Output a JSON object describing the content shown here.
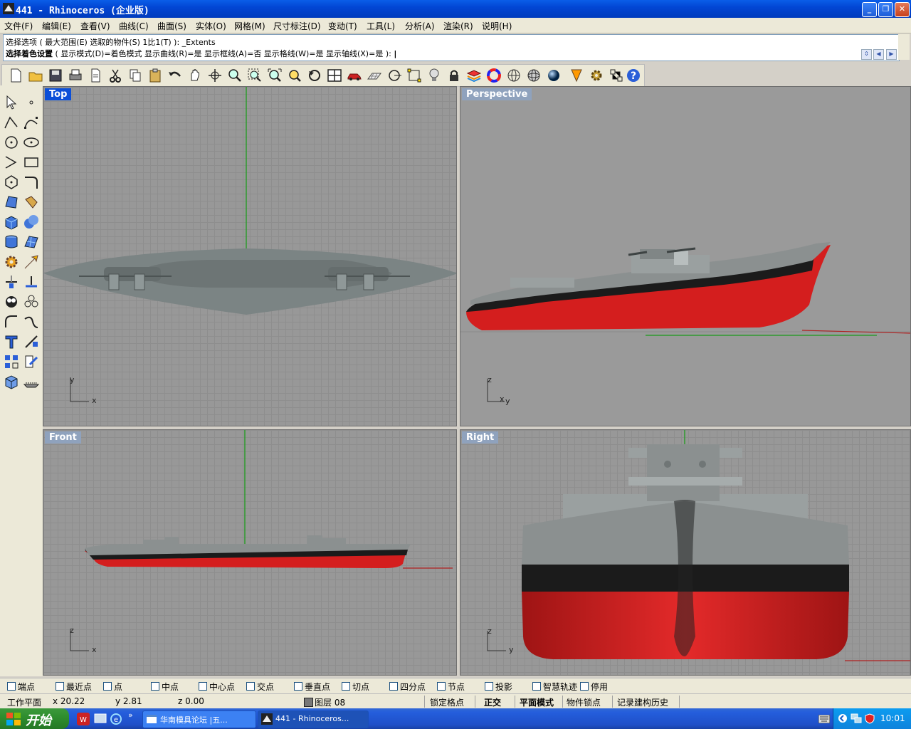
{
  "window": {
    "title": "441 - Rhinoceros (企业版)"
  },
  "menu": [
    "文件(F)",
    "编辑(E)",
    "查看(V)",
    "曲线(C)",
    "曲面(S)",
    "实体(O)",
    "网格(M)",
    "尺寸标注(D)",
    "变动(T)",
    "工具(L)",
    "分析(A)",
    "渲染(R)",
    "说明(H)"
  ],
  "command": {
    "history": "选择选项 ( 最大范围(E) 选取的物件(S) 1比1(T) ): _Extents",
    "prompt_bold": "选择着色设置",
    "prompt_rest": " ( 显示模式(D)=着色模式  显示曲线(R)=是  显示框线(A)=否  显示格线(W)=是  显示轴线(X)=是 ): "
  },
  "viewports": {
    "top": "Top",
    "perspective": "Perspective",
    "front": "Front",
    "right": "Right"
  },
  "axes": {
    "x": "x",
    "y": "y",
    "z": "z"
  },
  "osnap": [
    "端点",
    "最近点",
    "点",
    "中点",
    "中心点",
    "交点",
    "垂直点",
    "切点",
    "四分点",
    "节点",
    "投影",
    "智慧轨迹",
    "停用"
  ],
  "status": {
    "cplane": "工作平面",
    "x": "x 20.22",
    "y": "y 2.81",
    "z": "z 0.00",
    "layer": "图层 08",
    "grid_snap": "锁定格点",
    "ortho": "正交",
    "planar": "平面模式",
    "osnap": "物件锁点",
    "history": "记录建构历史"
  },
  "taskbar": {
    "start": "开始",
    "tasks": [
      "华南模具论坛 |五...",
      "441 - Rhinoceros..."
    ],
    "clock": "10:01"
  },
  "colors": {
    "hull_red": "#d41e1e",
    "hull_grey": "#8b9090",
    "active_label": "#0b4fd8"
  }
}
